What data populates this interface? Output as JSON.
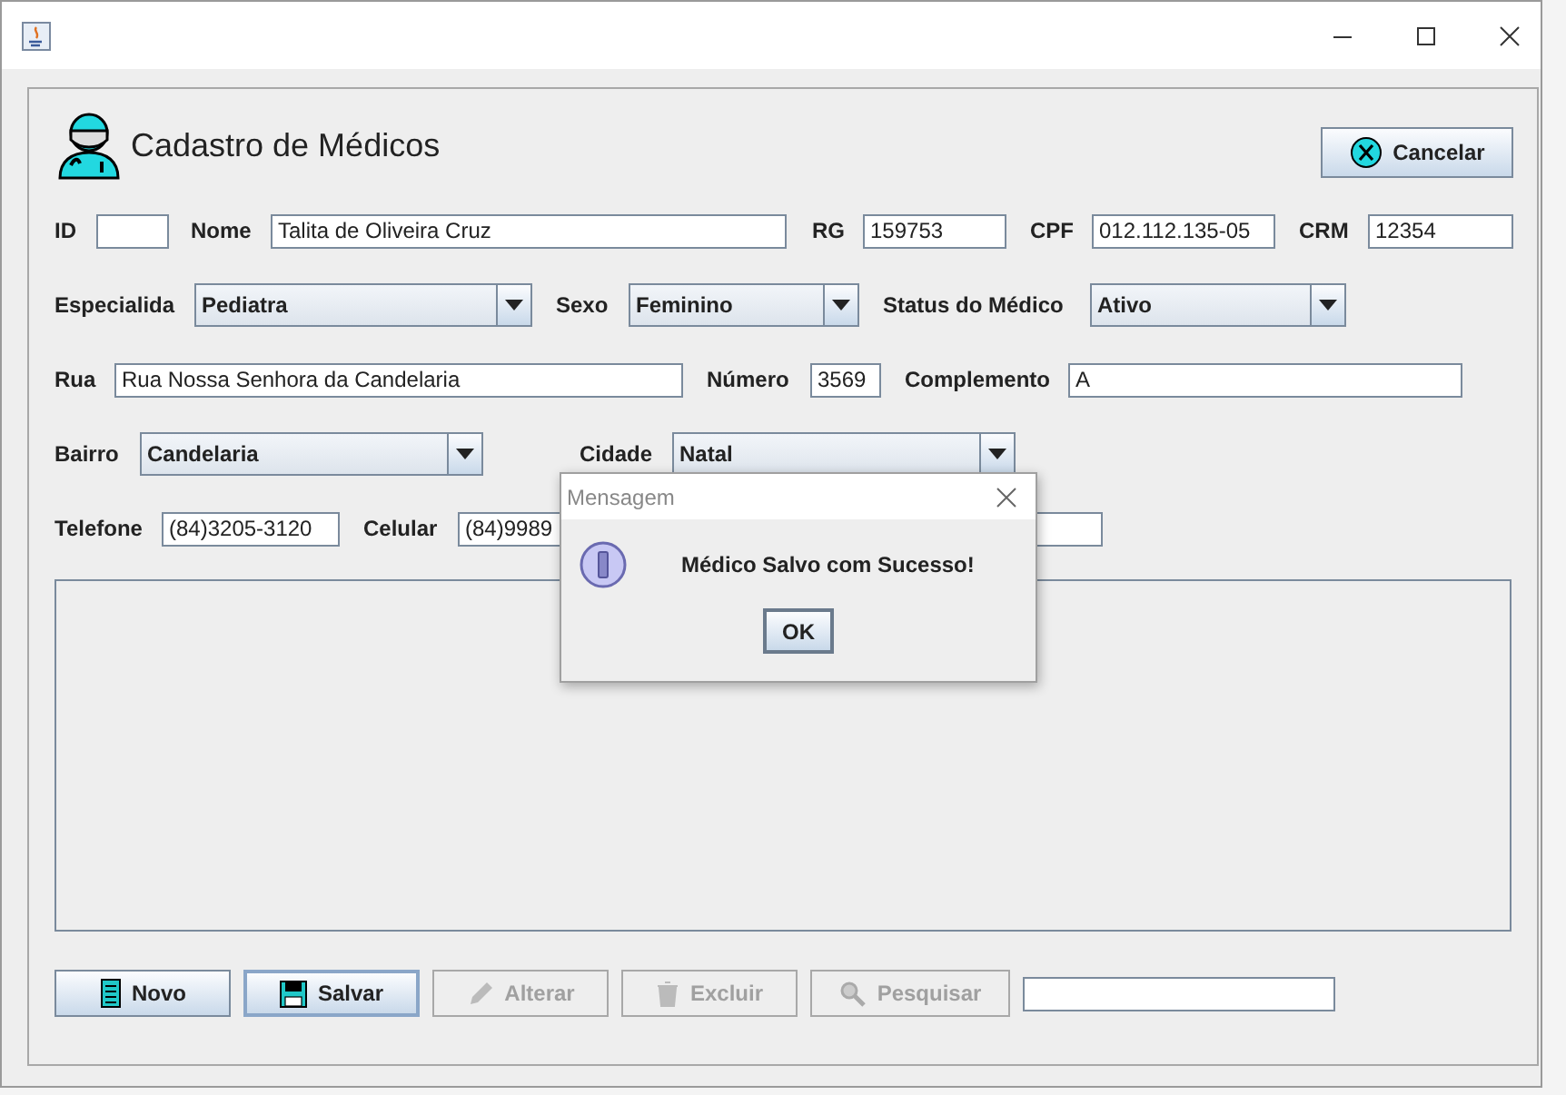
{
  "header": {
    "title": "Cadastro de Médicos",
    "cancel": "Cancelar"
  },
  "rows": [
    [
      {
        "kind": "field",
        "label": "ID"
      },
      {
        "kind": "field",
        "label": "Nome",
        "value": "Talita de Oliveira Cruz"
      },
      {
        "kind": "field",
        "label": "RG",
        "value": "159753"
      },
      {
        "kind": "field",
        "label": "CPF",
        "value": "012.112.135-05"
      },
      {
        "kind": "field",
        "label": "CRM",
        "value": "12354"
      }
    ],
    [
      {
        "kind": "combo",
        "label": "Especialida",
        "value": "Pediatra"
      },
      {
        "kind": "combo",
        "label": "Sexo",
        "value": "Feminino"
      },
      {
        "kind": "combo",
        "label": "Status do Médico",
        "value": "Ativo"
      }
    ],
    [
      {
        "kind": "field",
        "label": "Rua",
        "value": "Rua Nossa Senhora da Candelaria"
      },
      {
        "kind": "field",
        "label": "Número",
        "value": "3569"
      },
      {
        "kind": "field",
        "label": "Complemento",
        "value": "A"
      }
    ],
    [
      {
        "kind": "combo",
        "label": "Bairro",
        "value": "Candelaria"
      },
      {
        "kind": "combo",
        "label": "Cidade",
        "value": "Natal"
      }
    ],
    [
      {
        "kind": "field",
        "label": "Telefone",
        "value": "(84)3205-3120"
      },
      {
        "kind": "field",
        "label": "Celular",
        "value": "(84)9989"
      }
    ]
  ],
  "buttons": [
    {
      "label": "Novo",
      "disabled": false,
      "focused": false
    },
    {
      "label": "Salvar",
      "disabled": false,
      "focused": true
    },
    {
      "label": "Alterar",
      "disabled": true,
      "focused": false
    },
    {
      "label": "Excluir",
      "disabled": true,
      "focused": false
    },
    {
      "label": "Pesquisar",
      "disabled": true,
      "focused": false
    }
  ],
  "dialog": {
    "title": "Mensagem",
    "message": "Médico Salvo com Sucesso!",
    "button": "OK"
  }
}
